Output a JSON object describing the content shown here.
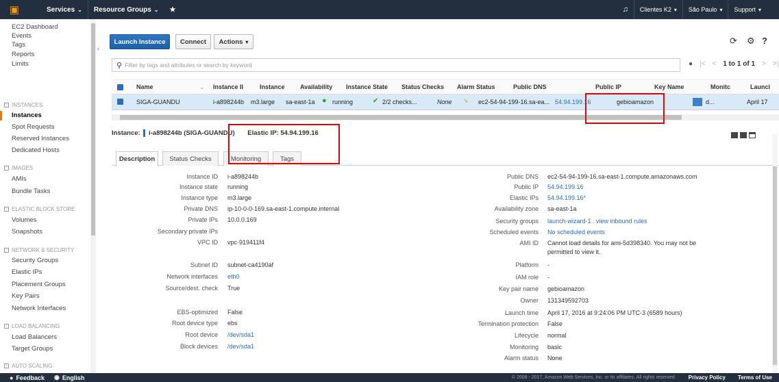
{
  "topnav": {
    "services": "Services",
    "resource_groups": "Resource Groups",
    "account": "Clientes K2",
    "region": "São Paulo",
    "support": "Support"
  },
  "sidebar": {
    "items": [
      {
        "label": "EC2 Dashboard"
      },
      {
        "label": "Events"
      },
      {
        "label": "Tags"
      },
      {
        "label": "Reports"
      },
      {
        "label": "Limits"
      }
    ],
    "instances_section": "INSTANCES",
    "instances_items": [
      "Instances",
      "Spot Requests",
      "Reserved Instances",
      "Dedicated Hosts"
    ],
    "images_section": "IMAGES",
    "images_items": [
      "AMIs",
      "Bundle Tasks"
    ],
    "ebs_section": "ELASTIC BLOCK STORE",
    "ebs_items": [
      "Volumes",
      "Snapshots"
    ],
    "network_section": "NETWORK & SECURITY",
    "network_items": [
      "Security Groups",
      "Elastic IPs",
      "Placement Groups",
      "Key Pairs",
      "Network Interfaces"
    ],
    "lb_section": "LOAD BALANCING",
    "lb_items": [
      "Load Balancers",
      "Target Groups"
    ],
    "as_section": "AUTO SCALING"
  },
  "toolbar": {
    "launch": "Launch Instance",
    "connect": "Connect",
    "actions": "Actions"
  },
  "search": {
    "placeholder": "Filter by tags and attributes or search by keyword"
  },
  "pager": {
    "text": "1 to 1 of 1"
  },
  "table": {
    "headers": [
      "Name",
      "Instance II",
      "Instance",
      "Availability",
      "Instance State",
      "Status Checks",
      "Alarm Status",
      "Public DNS",
      "Public IP",
      "Key Name",
      "Monitc",
      "Launcl"
    ],
    "row": {
      "name": "SIGA-GUANDU",
      "id": "i-a898244b",
      "type": "m3.large",
      "az": "sa-east-1a",
      "state": "running",
      "checks": "2/2 checks...",
      "alarm": "None",
      "dns": "ec2-54-94-199-16.sa-ea...",
      "ip": "54.94.199.16",
      "key": "gebioamazon",
      "monitor": "d...",
      "launch": "April 17"
    }
  },
  "details": {
    "instance_prefix": "Instance:",
    "instance_id": "i-a898244b (SIGA-GUANDU)",
    "elastic_ip": "Elastic IP: 54.94.199.16",
    "tabs": [
      "Description",
      "Status Checks",
      "Monitoring",
      "Tags"
    ],
    "left": [
      {
        "label": "Instance ID",
        "value": "i-a898244b"
      },
      {
        "label": "Instance state",
        "value": "running"
      },
      {
        "label": "Instance type",
        "value": "m3.large"
      },
      {
        "label": "Private DNS",
        "value": "ip-10-0-0-169.sa-east-1.compute.internal"
      },
      {
        "label": "Private IPs",
        "value": "10.0.0.169"
      },
      {
        "label": "Secondary private IPs",
        "value": ""
      },
      {
        "label": "VPC ID",
        "value": "vpc-919411f4"
      },
      {
        "label": "Subnet ID",
        "value": "subnet-ca4190af"
      },
      {
        "label": "Network interfaces",
        "value": "eth0"
      },
      {
        "label": "Source/dest. check",
        "value": "True"
      },
      {
        "label": "EBS-optimized",
        "value": "False"
      },
      {
        "label": "Root device type",
        "value": "ebs"
      },
      {
        "label": "Root device",
        "value": "/dev/sda1"
      },
      {
        "label": "Block devices",
        "value": "/dev/sda1"
      }
    ],
    "right": [
      {
        "label": "Public DNS",
        "value": "ec2-54-94-199-16.sa-east-1.compute.amazonaws.com"
      },
      {
        "label": "Public IP",
        "value": "54.94.199.16"
      },
      {
        "label": "Elastic IPs",
        "value": "54.94.199.16*"
      },
      {
        "label": "Availability zone",
        "value": "sa-east-1a"
      },
      {
        "label": "Security groups",
        "value": "launch-wizard-1 . view inbound rules"
      },
      {
        "label": "Scheduled events",
        "value": "No scheduled events"
      },
      {
        "label": "AMI ID",
        "value": "Cannot load details for ami-5d398340. You may not be"
      },
      {
        "label": "",
        "value": "permitted to view it."
      },
      {
        "label": "Platform",
        "value": "-"
      },
      {
        "label": "IAM role",
        "value": "-"
      },
      {
        "label": "Key pair name",
        "value": "gebioamazon"
      },
      {
        "label": "Owner",
        "value": "131349592703"
      },
      {
        "label": "Launch time",
        "value": "April 17, 2016 at 9:24:06 PM UTC-3 (6589 hours)"
      },
      {
        "label": "Termination protection",
        "value": "False"
      },
      {
        "label": "Lifecycle",
        "value": "normal"
      },
      {
        "label": "Monitoring",
        "value": "basic"
      },
      {
        "label": "Alarm status",
        "value": "None"
      }
    ]
  },
  "footer": {
    "feedback": "Feedback",
    "english": "English",
    "copyright": "© 2008 - 2017, Amazon Web Services, Inc. or its affiliates. All rights reserved.",
    "privacy": "Privacy Policy",
    "terms": "Terms of Use"
  },
  "colors": {
    "nav": "#232f3e",
    "primary": "#1e5fa8",
    "highlight": "#e00000",
    "link": "#2a6ebb"
  }
}
